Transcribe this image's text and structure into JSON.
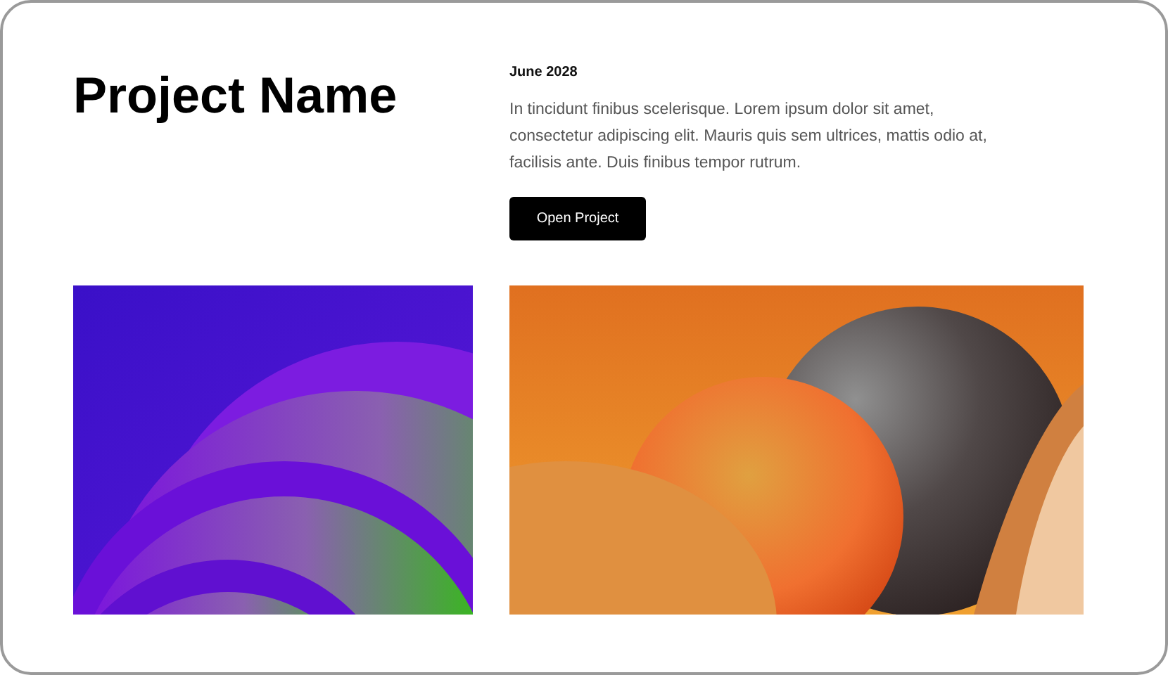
{
  "project": {
    "title": "Project Name",
    "date": "June 2028",
    "description": "In tincidunt finibus scelerisque. Lorem ipsum dolor sit amet, consectetur adipiscing elit. Mauris quis sem ultrices, mattis odio at, facilisis ante. Duis finibus tempor rutrum.",
    "button": "Open Project"
  }
}
